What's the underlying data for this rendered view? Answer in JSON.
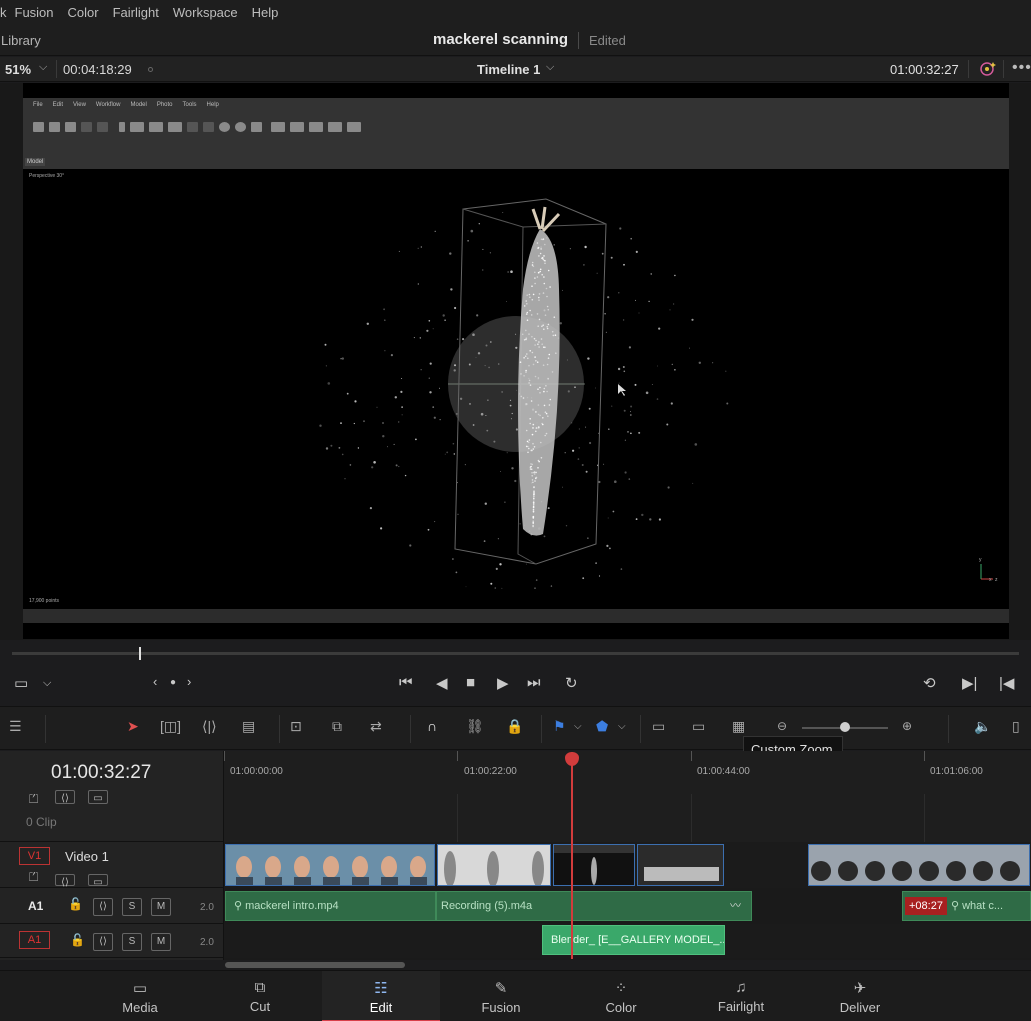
{
  "menu": {
    "items": [
      "k",
      "Fusion",
      "Color",
      "Fairlight",
      "Workspace",
      "Help"
    ]
  },
  "titlebar": {
    "library": "Library",
    "project": "mackerel scanning",
    "status": "Edited"
  },
  "viewer_bar": {
    "zoom": "51%",
    "source_timecode": "00:04:18:29",
    "timeline_name": "Timeline 1",
    "record_timecode": "01:00:32:27"
  },
  "inner_app": {
    "menu": [
      "File",
      "Edit",
      "View",
      "Workflow",
      "Model",
      "Photo",
      "Tools",
      "Help"
    ],
    "tab": "Model",
    "viewport_label": "Perspective 30°",
    "point_count": "17,900 points",
    "axis": {
      "y": "y",
      "x": "x",
      "z": "z"
    }
  },
  "timeline": {
    "timecode": "01:00:32:27",
    "ruler": [
      "01:00:00:00",
      "01:00:22:00",
      "01:00:44:00",
      "01:01:06:00"
    ],
    "tooltip": "Custom Zoom",
    "tracks": {
      "v2": {
        "clip_count": "0 Clip"
      },
      "v1": {
        "tag": "V1",
        "name": "Video 1"
      },
      "a1_top": {
        "tag": "A1",
        "solo": "S",
        "mute": "M",
        "level": "2.0"
      },
      "a1_bottom": {
        "tag": "A1",
        "solo": "S",
        "mute": "M",
        "level": "2.0"
      }
    },
    "audio_clips": {
      "c1": "mackerel intro.mp4",
      "c2": "Recording (5).m4a",
      "c3": "what c...",
      "c4": "Blender_ [E__GALLERY MODEL_..."
    },
    "offset_badge": "+08:27"
  },
  "pages": [
    {
      "label": "Media",
      "icon": "media-icon"
    },
    {
      "label": "Cut",
      "icon": "cut-icon"
    },
    {
      "label": "Edit",
      "icon": "edit-icon",
      "active": true
    },
    {
      "label": "Fusion",
      "icon": "fusion-icon"
    },
    {
      "label": "Color",
      "icon": "color-icon"
    },
    {
      "label": "Fairlight",
      "icon": "fairlight-icon"
    },
    {
      "label": "Deliver",
      "icon": "deliver-icon"
    }
  ],
  "colors": {
    "accent": "#d8404a",
    "playhead": "#d23c3c",
    "audio_clip": "#2f6b46",
    "video_clip": "#1b3a66"
  }
}
